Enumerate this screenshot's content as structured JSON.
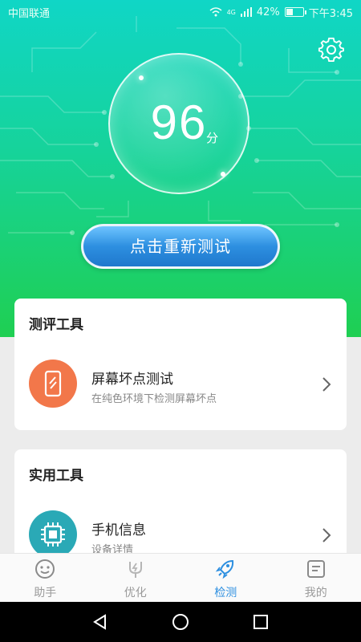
{
  "status_bar": {
    "carrier": "中国联通",
    "network": "4G",
    "battery": "42%",
    "battery_level": 0.42,
    "time": "下午3:45"
  },
  "score": {
    "value": "96",
    "unit": "分"
  },
  "retest_label": "点击重新测试",
  "sections": [
    {
      "title": "测评工具",
      "tool": {
        "name": "屏幕坏点测试",
        "desc": "在纯色环境下检测屏幕坏点",
        "icon": "phone-screen-icon",
        "color": "#f2774a"
      }
    },
    {
      "title": "实用工具",
      "tool": {
        "name": "手机信息",
        "desc": "设备详情",
        "icon": "chip-icon",
        "color": "#2aa9b6"
      }
    }
  ],
  "nav": {
    "items": [
      {
        "label": "助手",
        "icon": "assistant-icon"
      },
      {
        "label": "优化",
        "icon": "optimize-icon"
      },
      {
        "label": "检测",
        "icon": "rocket-icon"
      },
      {
        "label": "我的",
        "icon": "profile-icon"
      }
    ],
    "active": 2
  },
  "colors": {
    "accent": "#2d8fe0",
    "hero_top": "#10d6c6",
    "hero_bottom": "#1fcf52"
  }
}
